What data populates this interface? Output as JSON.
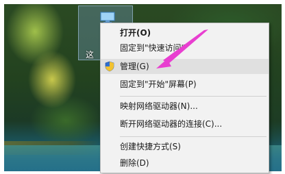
{
  "desktop_icon": {
    "label": "这"
  },
  "menu": {
    "items": [
      {
        "label": "打开(O)",
        "bold": true,
        "icon": ""
      },
      {
        "label": "固定到\"快速访问\"",
        "icon": ""
      },
      {
        "label": "管理(G)",
        "icon": "shield-uac-icon",
        "highlighted": true
      },
      {
        "label": "固定到\"开始\"屏幕(P)",
        "icon": ""
      },
      {
        "label": "映射网络驱动器(N)...",
        "icon": ""
      },
      {
        "label": "断开网络驱动器的连接(C)...",
        "icon": ""
      },
      {
        "label": "创建快捷方式(S)",
        "icon": ""
      },
      {
        "label": "删除(D)",
        "icon": ""
      }
    ]
  },
  "annotation": {
    "arrow_color": "#e83fd0",
    "arrow_icon": "arrow-icon"
  },
  "colors": {
    "menu_bg": "#f2f2f2",
    "highlight": "#e0e0e0",
    "accent": "#e83fd0"
  }
}
